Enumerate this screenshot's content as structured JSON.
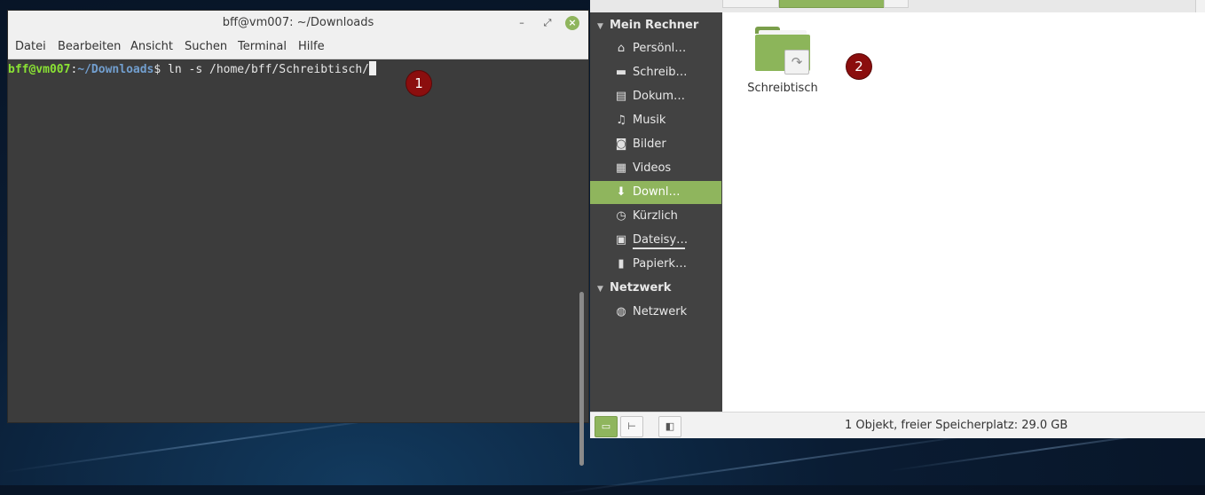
{
  "terminal": {
    "title": "bff@vm007: ~/Downloads",
    "buttons": {
      "minimize": "–",
      "maximize": "⤢",
      "close": "×"
    },
    "menu": [
      "Datei",
      "Bearbeiten",
      "Ansicht",
      "Suchen",
      "Terminal",
      "Hilfe"
    ],
    "prompt": {
      "user_host": "bff@vm007",
      "sep": ":",
      "path": "~/Downloads",
      "symbol": "$ ",
      "command": "ln -s /home/bff/Schreibtisch/"
    },
    "colors": {
      "user": "#8ae234",
      "path": "#729fcf",
      "background": "#3c3c3c"
    }
  },
  "badges": [
    "1",
    "2"
  ],
  "file_manager": {
    "sidebar": {
      "sections": [
        {
          "header": "Mein Rechner",
          "items": [
            {
              "label": "Persönl…",
              "icon": "home-icon",
              "glyph": "⌂"
            },
            {
              "label": "Schreib…",
              "icon": "desktop-icon",
              "glyph": "▬"
            },
            {
              "label": "Dokum…",
              "icon": "document-icon",
              "glyph": "▤"
            },
            {
              "label": "Musik",
              "icon": "music-icon",
              "glyph": "♫"
            },
            {
              "label": "Bilder",
              "icon": "camera-icon",
              "glyph": "◙"
            },
            {
              "label": "Videos",
              "icon": "film-icon",
              "glyph": "▦"
            },
            {
              "label": "Downl…",
              "icon": "download-icon",
              "glyph": "⬇",
              "active": true
            },
            {
              "label": "Kürzlich",
              "icon": "clock-icon",
              "glyph": "◷"
            },
            {
              "label": "Dateisy…",
              "icon": "drive-icon",
              "glyph": "▣"
            },
            {
              "label": "Papierk…",
              "icon": "trash-icon",
              "glyph": "▮"
            }
          ]
        },
        {
          "header": "Netzwerk",
          "items": [
            {
              "label": "Netzwerk",
              "icon": "globe-icon",
              "glyph": "◍"
            }
          ]
        }
      ]
    },
    "content": {
      "files": [
        {
          "name": "Schreibtisch",
          "type": "folder-symlink"
        }
      ],
      "link_glyph": "↷"
    },
    "statusbar": {
      "text": "1 Objekt, freier Speicherplatz: 29.0 GB",
      "buttons": [
        {
          "name": "places-view-button",
          "glyph": "▭"
        },
        {
          "name": "tree-view-button",
          "glyph": "⊢"
        },
        {
          "name": "toggle-sidebar-button",
          "glyph": "◧"
        }
      ]
    },
    "accent_color": "#8fb55d"
  }
}
